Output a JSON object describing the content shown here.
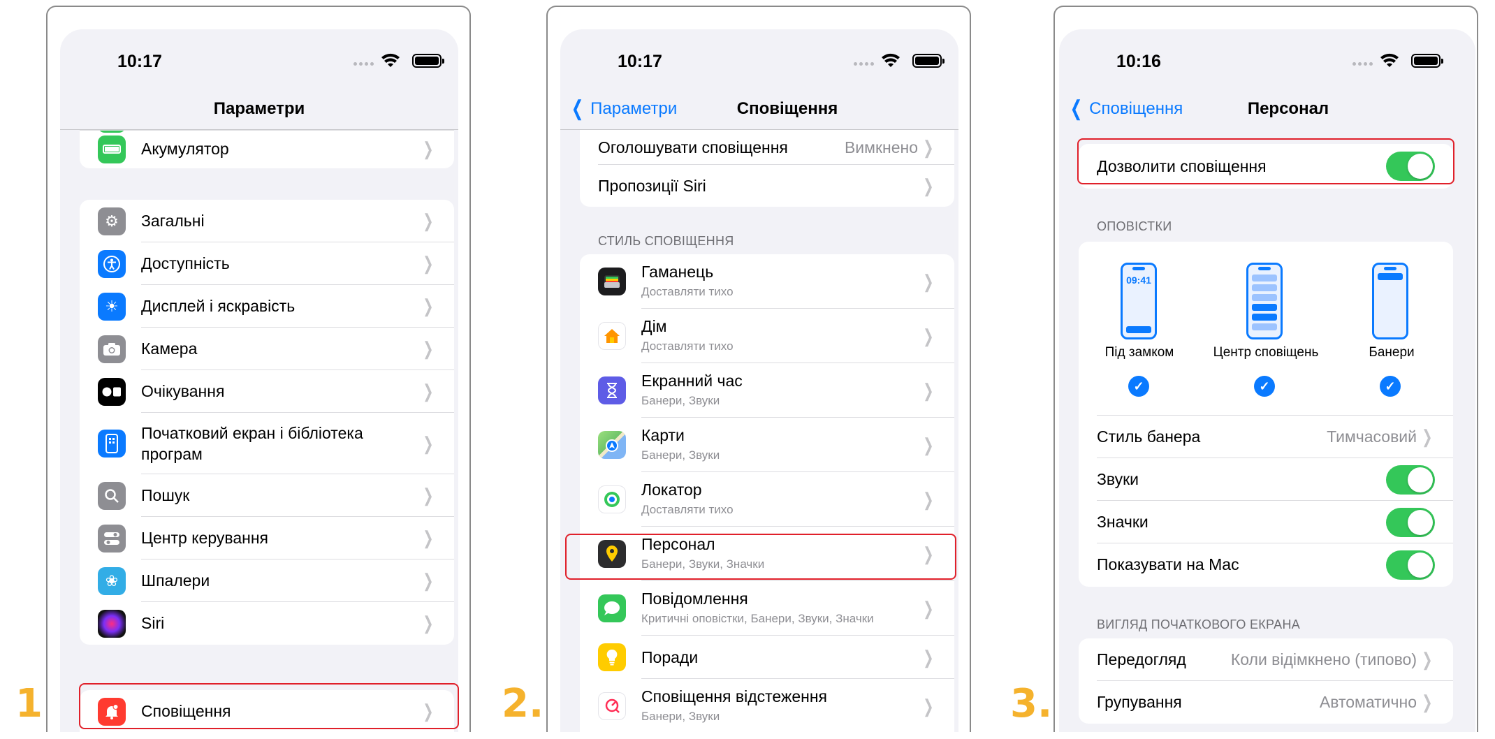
{
  "steps": [
    "1.",
    "2.",
    "3."
  ],
  "panel1": {
    "time": "10:17",
    "title": "Параметри",
    "top_item": "Акумулятор",
    "items": [
      "Загальні",
      "Доступність",
      "Дисплей і яскравість",
      "Камера",
      "Очікування",
      "Початковий екран і бібліотека програм",
      "Пошук",
      "Центр керування",
      "Шпалери",
      "Siri"
    ],
    "bottom_item": "Сповіщення"
  },
  "panel2": {
    "time": "10:17",
    "back": "Параметри",
    "title": "Сповіщення",
    "announce_label": "Оголошувати сповіщення",
    "announce_value": "Вимкнено",
    "siri_label": "Пропозиції Siri",
    "section": "СТИЛЬ СПОВІЩЕННЯ",
    "apps": [
      {
        "name": "Гаманець",
        "sub": "Доставляти тихо"
      },
      {
        "name": "Дім",
        "sub": "Доставляти тихо"
      },
      {
        "name": "Екранний час",
        "sub": "Банери, Звуки"
      },
      {
        "name": "Карти",
        "sub": "Банери, Звуки"
      },
      {
        "name": "Локатор",
        "sub": "Доставляти тихо"
      },
      {
        "name": "Персонал",
        "sub": "Банери, Звуки, Значки"
      },
      {
        "name": "Повідомлення",
        "sub": "Критичні оповістки, Банери, Звуки, Значки"
      },
      {
        "name": "Поради",
        "sub": ""
      },
      {
        "name": "Сповіщення відстеження",
        "sub": "Банери, Звуки"
      }
    ]
  },
  "panel3": {
    "time": "10:16",
    "back": "Сповіщення",
    "title": "Персонал",
    "allow_label": "Дозволити сповіщення",
    "alerts_section": "ОПОВІСТКИ",
    "phone_time": "09:41",
    "styles": [
      "Під замком",
      "Центр сповіщень",
      "Банери"
    ],
    "banner_style_label": "Стиль банера",
    "banner_style_value": "Тимчасовий",
    "sounds_label": "Звуки",
    "badges_label": "Значки",
    "mac_label": "Показувати на Mac",
    "lock_section": "ВИГЛЯД ПОЧАТКОВОГО ЕКРАНА",
    "preview_label": "Передогляд",
    "preview_value": "Коли відімкнено (типово)",
    "grouping_label": "Групування",
    "grouping_value": "Автоматично"
  }
}
